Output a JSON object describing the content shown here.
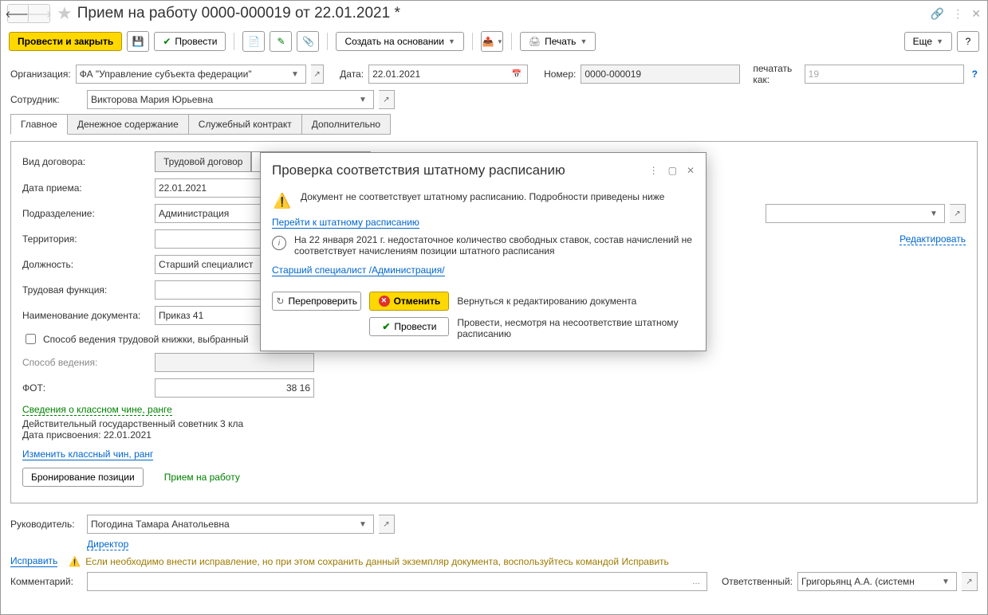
{
  "title": "Прием на работу 0000-000019 от 22.01.2021 *",
  "toolbar": {
    "post_close": "Провести и закрыть",
    "post": "Провести",
    "create_basis": "Создать на основании",
    "print": "Печать",
    "more": "Еще",
    "help": "?"
  },
  "fields": {
    "org_label": "Организация:",
    "org_value": "ФА \"Управление субъекта федерации\"",
    "date_label": "Дата:",
    "date_value": "22.01.2021",
    "num_label": "Номер:",
    "num_value": "0000-000019",
    "print_as_label": "печатать как:",
    "print_as_value": "19",
    "emp_label": "Сотрудник:",
    "emp_value": "Викторова Мария Юрьевна"
  },
  "tabs": {
    "main": "Главное",
    "money": "Денежное содержание",
    "contract": "Служебный контракт",
    "extra": "Дополнительно"
  },
  "main": {
    "contract_type_label": "Вид договора:",
    "contract_type_1": "Трудовой договор",
    "accept_date_label": "Дата приема:",
    "accept_date_value": "22.01.2021",
    "division_label": "Подразделение:",
    "division_value": "Администрация",
    "edit_link": "Редактировать",
    "territory_label": "Территория:",
    "position_label": "Должность:",
    "position_value": "Старший специалист",
    "func_label": "Трудовая функция:",
    "doc_name_label": "Наименование документа:",
    "doc_name_value": "Приказ 41",
    "workbook_check": "Способ ведения трудовой книжки, выбранный",
    "method_label": "Способ ведения:",
    "fot_label": "ФОТ:",
    "fot_value": "38 16",
    "rank_header": "Сведения о классном чине, ранге",
    "rank_text": "Действительный государственный советник 3 кла",
    "rank_date": "Дата присвоения: 22.01.2021",
    "change_rank": "Изменить классный чин, ранг",
    "bron_btn": "Бронирование позиции",
    "accept_str": "Прием на работу"
  },
  "footer": {
    "head_label": "Руководитель:",
    "head_value": "Погодина Тамара Анатольевна",
    "head_post": "Директор",
    "fix_link": "Исправить",
    "fix_text": "Если необходимо внести исправление, но при этом сохранить данный экземпляр документа, воспользуйтесь командой Исправить",
    "comment_label": "Комментарий:",
    "resp_label": "Ответственный:",
    "resp_value": "Григорьянц А.А. (системн"
  },
  "dialog": {
    "title": "Проверка соответствия штатному расписанию",
    "warn_text": "Документ не соответствует штатному расписанию. Подробности приведены ниже",
    "link1": "Перейти к штатному расписанию",
    "info_text": "На 22 января 2021 г. недостаточное количество свободных ставок, состав начислений не соответствует начислениям позиции штатного расписания",
    "link2": "Старший специалист /Администрация/",
    "recheck": "Перепроверить",
    "cancel": "Отменить",
    "cancel_text": "Вернуться к редактированию документа",
    "post": "Провести",
    "post_text": "Провести, несмотря на несоответствие штатному расписанию"
  }
}
